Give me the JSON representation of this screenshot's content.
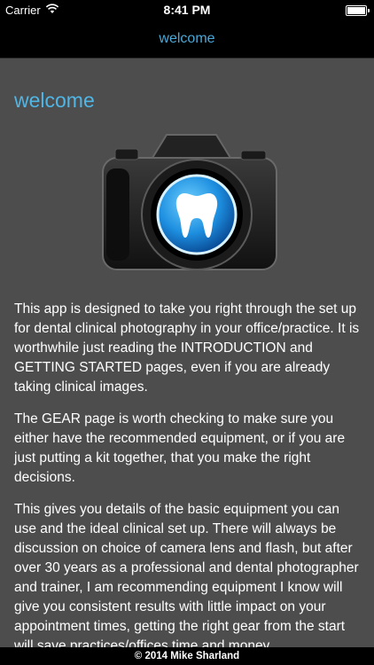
{
  "status_bar": {
    "carrier": "Carrier",
    "time": "8:41 PM",
    "wifi_icon": "wifi-icon",
    "battery_icon": "battery-icon"
  },
  "nav": {
    "title": "welcome"
  },
  "main": {
    "heading": "welcome",
    "logo_icon": "camera-tooth-logo",
    "paragraphs": [
      "This app is designed to take you right through the set up for dental clinical photography in your office/practice. It is worthwhile just reading the INTRODUCTION and GETTING STARTED pages, even if you are already taking clinical images.",
      "The GEAR page is worth checking to make sure you either have the recommended equipment, or if you are just putting a kit together, that you make the right decisions.",
      "This gives you details of the basic equipment you can use and the ideal clinical set up. There will always be discussion on choice of camera lens and flash, but after over 30 years as a professional and dental photographer and trainer, I am recommending equipment I know will give you consistent results with little impact on your appointment times, getting the right gear from the start will save practices/offices time and money."
    ]
  },
  "footer": {
    "text": "© 2014 Mike Sharland"
  },
  "colors": {
    "accent": "#4aa8d8",
    "content_bg": "#4d4d4d",
    "bar_bg": "#000000"
  }
}
